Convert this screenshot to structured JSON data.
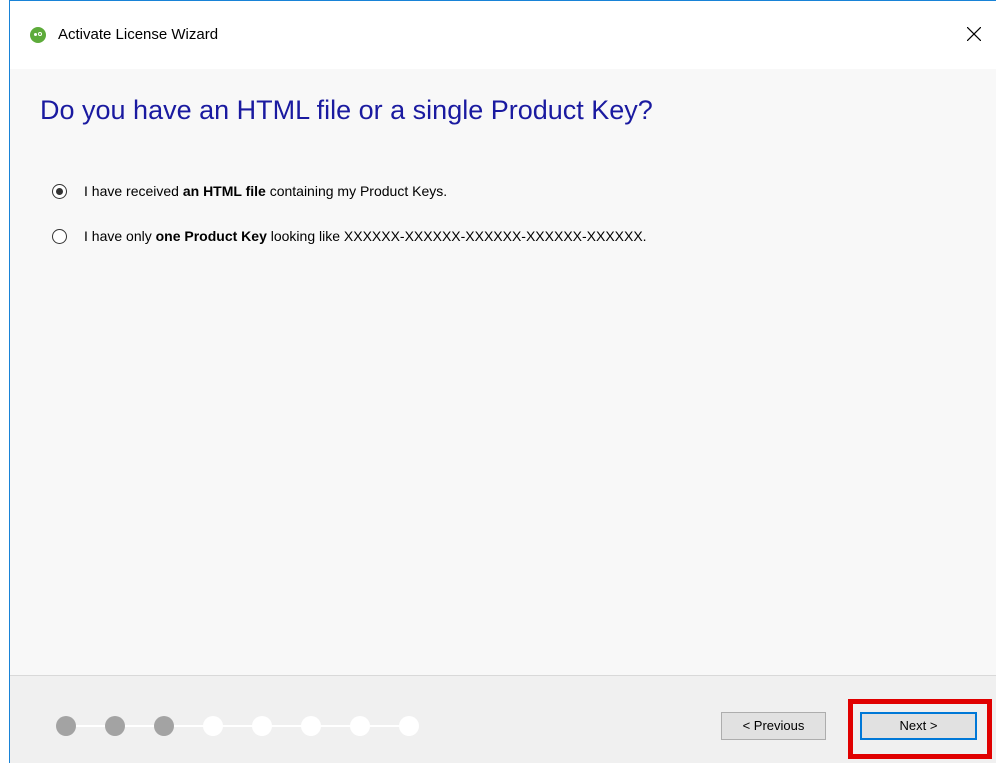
{
  "window": {
    "title": "Activate License Wizard",
    "app_icon": "app-logo-icon",
    "close_icon": "close-icon"
  },
  "main": {
    "heading": "Do you have an HTML file or a single Product Key?",
    "options": [
      {
        "prefix": "I have received ",
        "bold": "an HTML file",
        "suffix": " containing my Product Keys.",
        "selected": true
      },
      {
        "prefix": "I have only ",
        "bold": "one Product Key",
        "suffix": " looking like XXXXXX-XXXXXX-XXXXXX-XXXXXX-XXXXXX.",
        "selected": false
      }
    ]
  },
  "footer": {
    "steps_total": 8,
    "steps_completed": 3,
    "previous_label": "< Previous",
    "next_label": "Next >",
    "highlight_color": "#e00000"
  },
  "colors": {
    "heading": "#1a1aa0",
    "accent": "#0078d7",
    "window_border": "#1883d7",
    "step_done": "#a3a3a3"
  }
}
